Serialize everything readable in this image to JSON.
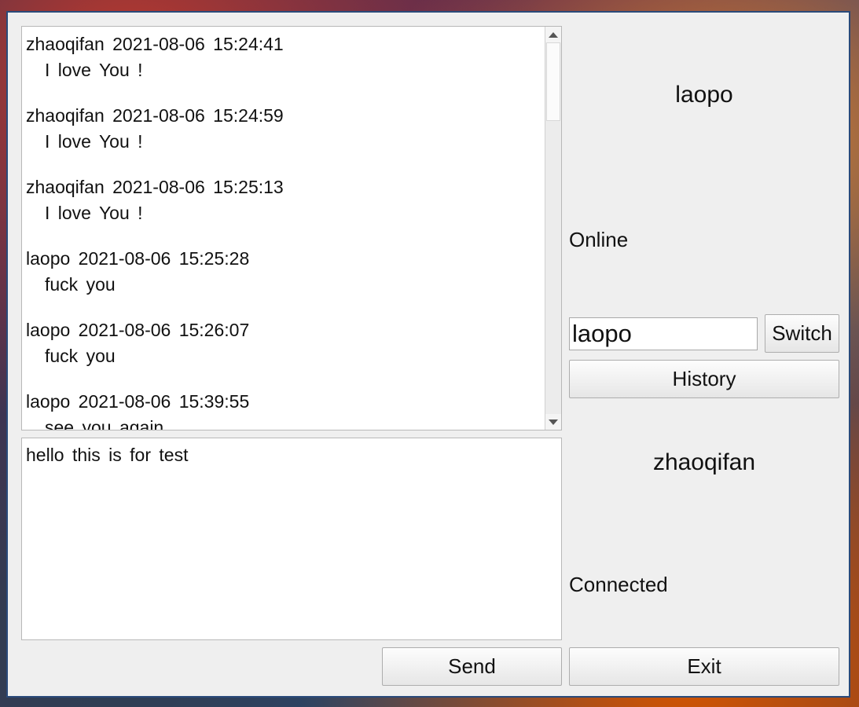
{
  "chat": {
    "messages": [
      {
        "header": "zhaoqifan  2021-08-06  15:24:41",
        "body": "I  love  You  !"
      },
      {
        "header": "zhaoqifan  2021-08-06  15:24:59",
        "body": "I  love  You  !"
      },
      {
        "header": "zhaoqifan  2021-08-06  15:25:13",
        "body": "I  love  You  !"
      },
      {
        "header": "laopo  2021-08-06  15:25:28",
        "body": "fuck  you"
      },
      {
        "header": "laopo  2021-08-06  15:26:07",
        "body": "fuck  you"
      },
      {
        "header": "laopo  2021-08-06  15:39:55",
        "body": "see  you  again"
      }
    ]
  },
  "compose": {
    "text": "hello  this  is  for  test"
  },
  "peer": {
    "name": "laopo",
    "status": "Online"
  },
  "switch_input": {
    "value": "laopo"
  },
  "buttons": {
    "switch": "Switch",
    "history": "History",
    "send": "Send",
    "exit": "Exit"
  },
  "self": {
    "name": "zhaoqifan",
    "status": "Connected"
  },
  "icons": {
    "scroll_up": "triangle-up-icon",
    "scroll_down": "triangle-down-icon"
  }
}
